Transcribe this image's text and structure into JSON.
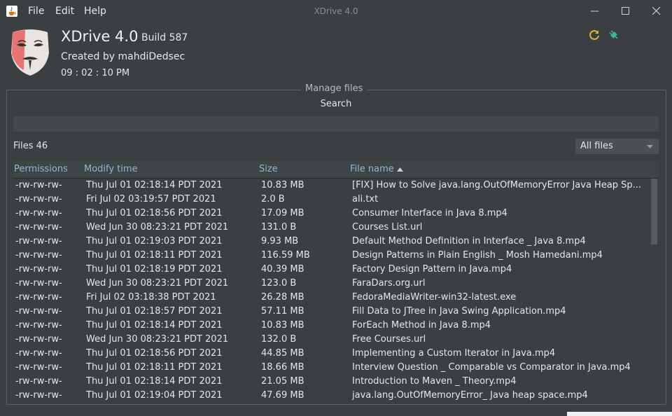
{
  "window": {
    "title": "XDrive 4.0"
  },
  "menu": {
    "file": "File",
    "edit": "Edit",
    "help": "Help"
  },
  "header": {
    "app_name": "XDrive 4.0",
    "build": "Build 587",
    "created_by": "Created by mahdiDedsec",
    "clock": "09 : 02 : 10 PM"
  },
  "panel": {
    "title": "Manage files",
    "search_label": "Search",
    "search_value": "",
    "files_count": "Files 46",
    "filter_value": "All files"
  },
  "table": {
    "headers": {
      "permissions": "Permissions",
      "modify_time": "Modify time",
      "size": "Size",
      "file_name": "File name"
    },
    "sort": {
      "column": "File name",
      "direction": "ascending"
    },
    "rows": [
      {
        "perm": "-rw-rw-rw-",
        "time": "Thu Jul 01 02:18:14 PDT 2021",
        "size": "10.83 MB",
        "name": "[FIX] How to Solve java.lang.OutOfMemoryError Java Heap Sp..."
      },
      {
        "perm": "-rw-rw-rw-",
        "time": "Fri Jul 02 03:19:57 PDT 2021",
        "size": "2.0 B",
        "name": "ali.txt"
      },
      {
        "perm": "-rw-rw-rw-",
        "time": "Thu Jul 01 02:18:56 PDT 2021",
        "size": "17.09 MB",
        "name": "Consumer Interface in Java 8.mp4"
      },
      {
        "perm": "-rw-rw-rw-",
        "time": "Wed Jun 30 08:23:21 PDT 2021",
        "size": "131.0 B",
        "name": "Courses List.url"
      },
      {
        "perm": "-rw-rw-rw-",
        "time": "Thu Jul 01 02:19:03 PDT 2021",
        "size": "9.93 MB",
        "name": "Default Method Definition in Interface _ Java 8.mp4"
      },
      {
        "perm": "-rw-rw-rw-",
        "time": "Thu Jul 01 02:18:11 PDT 2021",
        "size": "116.59 MB",
        "name": "Design Patterns in Plain English _ Mosh Hamedani.mp4"
      },
      {
        "perm": "-rw-rw-rw-",
        "time": "Thu Jul 01 02:18:19 PDT 2021",
        "size": "40.39 MB",
        "name": "Factory Design Pattern in Java.mp4"
      },
      {
        "perm": "-rw-rw-rw-",
        "time": "Wed Jun 30 08:23:21 PDT 2021",
        "size": "123.0 B",
        "name": "FaraDars.org.url"
      },
      {
        "perm": "-rw-rw-rw-",
        "time": "Fri Jul 02 03:18:38 PDT 2021",
        "size": "26.28 MB",
        "name": "FedoraMediaWriter-win32-latest.exe"
      },
      {
        "perm": "-rw-rw-rw-",
        "time": "Thu Jul 01 02:18:57 PDT 2021",
        "size": "57.11 MB",
        "name": "Fill Data to JTree in Java Swing Application.mp4"
      },
      {
        "perm": "-rw-rw-rw-",
        "time": "Thu Jul 01 02:18:14 PDT 2021",
        "size": "10.83 MB",
        "name": "ForEach Method in Java 8.mp4"
      },
      {
        "perm": "-rw-rw-rw-",
        "time": "Wed Jun 30 08:23:21 PDT 2021",
        "size": "132.0 B",
        "name": "Free Courses.url"
      },
      {
        "perm": "-rw-rw-rw-",
        "time": "Thu Jul 01 02:18:56 PDT 2021",
        "size": "44.85 MB",
        "name": "Implementing a Custom Iterator in Java.mp4"
      },
      {
        "perm": "-rw-rw-rw-",
        "time": "Thu Jul 01 02:18:11 PDT 2021",
        "size": "18.66 MB",
        "name": "Interview Question _ Comparable vs Comparator in Java.mp4"
      },
      {
        "perm": "-rw-rw-rw-",
        "time": "Thu Jul 01 02:18:14 PDT 2021",
        "size": "21.05 MB",
        "name": "Introduction to Maven _ Theory.mp4"
      },
      {
        "perm": "-rw-rw-rw-",
        "time": "Thu Jul 01 02:19:04 PDT 2021",
        "size": "47.69 MB",
        "name": "java.lang.OutOfMemoryError_ Java heap space.mp4"
      }
    ]
  },
  "icons": {
    "app": "java-cup-icon",
    "logo": "mask-logo-icon",
    "refresh": "refresh-icon",
    "connect": "plug-icon"
  },
  "colors": {
    "background": "#3c3f41",
    "header_text": "#8fb8d8",
    "refresh": "#e3b23c",
    "connect": "#3fb39a"
  }
}
